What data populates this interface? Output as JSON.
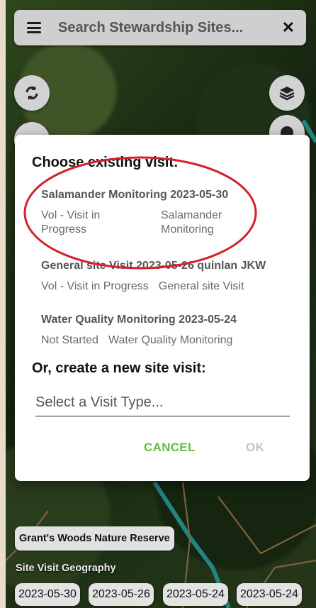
{
  "search": {
    "placeholder": "Search Stewardship Sites..."
  },
  "dialog": {
    "title": "Choose existing visit:",
    "visits": [
      {
        "title": "Salamander Monitoring 2023-05-30",
        "status": "Vol - Visit in Progress",
        "type": "Salamander Monitoring"
      },
      {
        "title": "General site Visit 2023-05-26 quinlan JKW",
        "status": "Vol - Visit in Progress",
        "type": "General site Visit"
      },
      {
        "title": "Water Quality Monitoring 2023-05-24",
        "status": "Not Started",
        "type": "Water Quality Monitoring"
      }
    ],
    "new_title": "Or, create a new site visit:",
    "select_placeholder": "Select a Visit Type...",
    "cancel_label": "CANCEL",
    "ok_label": "OK"
  },
  "map": {
    "reserve_label": "Grant's Woods Nature Reserve",
    "geography_label": "Site Visit Geography",
    "date_chips": [
      "2023-05-30",
      "2023-05-26",
      "2023-05-24",
      "2023-05-24"
    ]
  },
  "colors": {
    "accent": "#67bb3f",
    "highlight": "#d3202a",
    "stream": "#33c4c0"
  },
  "icons": {
    "menu": "menu-icon",
    "close": "close-icon",
    "refresh": "refresh-icon",
    "layers": "layers-icon",
    "compass": "compass-icon"
  }
}
